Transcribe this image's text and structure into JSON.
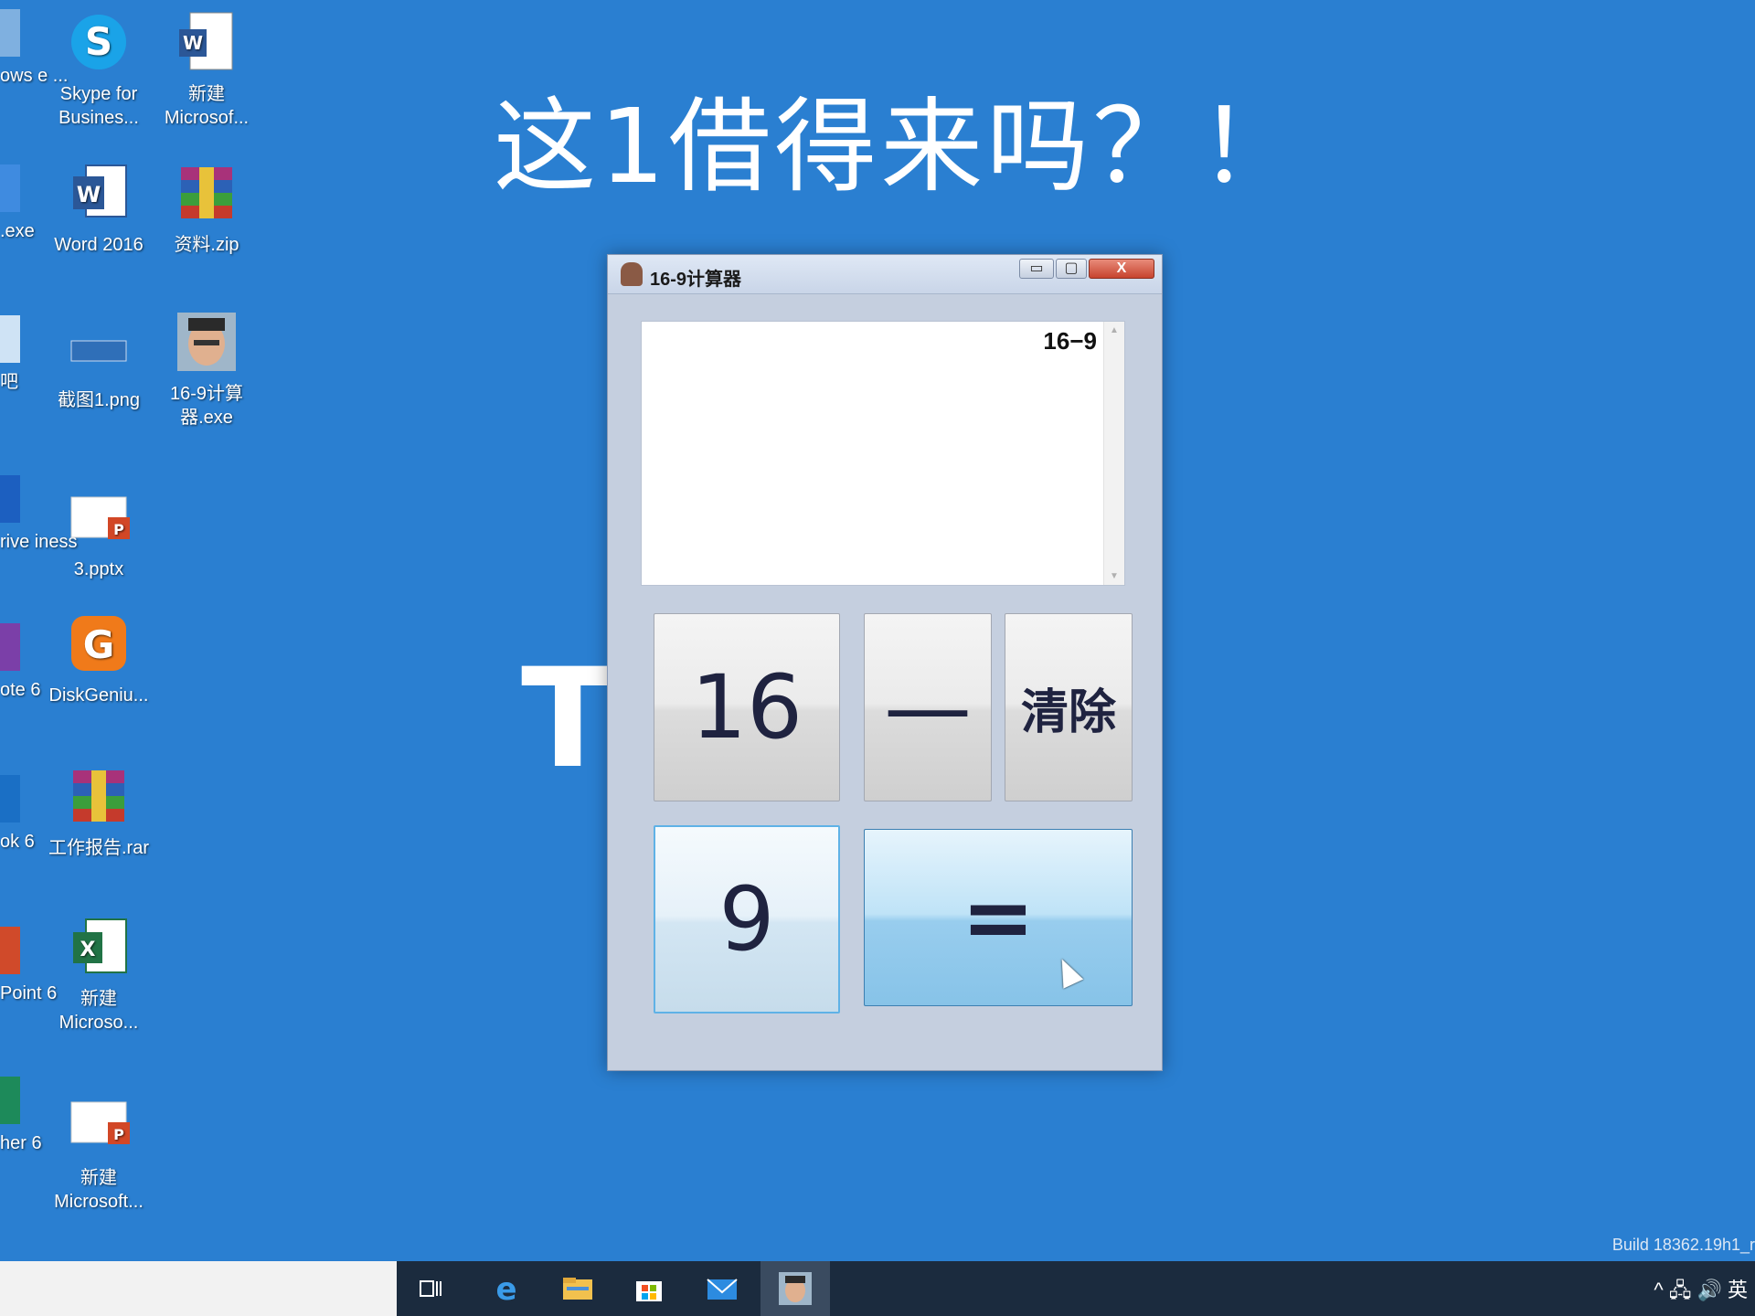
{
  "caption": "这1借得来吗？！",
  "background_word": "Think",
  "desktop_icons": [
    {
      "label": "Skype for Busines...",
      "icon": "skype-icon"
    },
    {
      "label": "新建 Microsof...",
      "icon": "word-doc-icon"
    },
    {
      "label": "Word 2016",
      "icon": "word-icon"
    },
    {
      "label": "资料.zip",
      "icon": "winrar-icon"
    },
    {
      "label": "截图1.png",
      "icon": "image-icon"
    },
    {
      "label": "16-9计算器.exe",
      "icon": "app-avatar-icon"
    },
    {
      "label": "3.pptx",
      "icon": "pptx-icon"
    },
    {
      "label": "DiskGeniu...",
      "icon": "diskgenius-icon"
    },
    {
      "label": "工作报告.rar",
      "icon": "winrar-icon"
    },
    {
      "label": "新建 Microso...",
      "icon": "excel-icon"
    },
    {
      "label": "新建 Microsoft...",
      "icon": "pptx-icon"
    }
  ],
  "partial_icons": [
    {
      "label": "ows e ..."
    },
    {
      "label": ".exe"
    },
    {
      "label": "吧"
    },
    {
      "label": "rive iness"
    },
    {
      "label": "ote 6"
    },
    {
      "label": "ok 6"
    },
    {
      "label": "Point 6"
    },
    {
      "label": "her 6"
    }
  ],
  "window": {
    "title": "16-9计算器",
    "minimize": "▭",
    "maximize": "▢",
    "close": "X"
  },
  "display": {
    "expression": "16−9"
  },
  "buttons": {
    "b16": "16",
    "minus": "—",
    "clear": "清除",
    "b9": "9",
    "equals": "="
  },
  "taskbar": {
    "tray_text": "^ 🖧 🔊 英"
  },
  "build": "Build 18362.19h1_r",
  "colors": {
    "desktop": "#2a7fd1",
    "taskbar": "#1b2b3e",
    "equals_button": "#98cdee"
  }
}
